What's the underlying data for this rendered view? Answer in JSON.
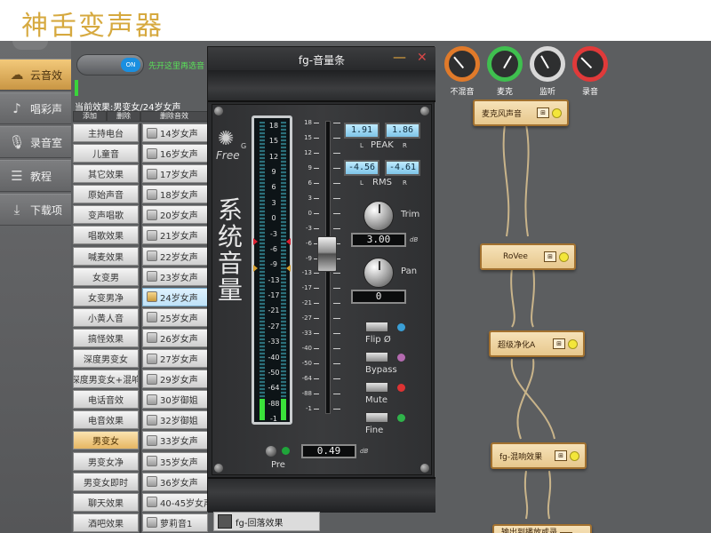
{
  "page_title": "神舌变声器",
  "nav": {
    "items": [
      {
        "label": "云音效",
        "icon": "cloud-icon"
      },
      {
        "label": "唱彩声",
        "icon": "microphone-hand-icon"
      },
      {
        "label": "录音室",
        "icon": "microphone-icon"
      },
      {
        "label": "教程",
        "icon": "tutorial-icon"
      },
      {
        "label": "下载项",
        "icon": "download-icon"
      }
    ]
  },
  "toggle": {
    "state": "ON",
    "hint": "先开这里再选音"
  },
  "effects": {
    "current_label": "当前效果:男变女/24岁女声",
    "headers": [
      "添加",
      "删除",
      "删除音效"
    ],
    "left_items": [
      "主持电台",
      "儿童音",
      "其它效果",
      "原始声音",
      "变声唱歌",
      "唱歌效果",
      "喊麦效果",
      "女变男",
      "女变男净",
      "小黄人音",
      "搞怪效果",
      "深度男变女",
      "深度男变女+混响",
      "电话音效",
      "电音效果",
      "男变女",
      "男变女净",
      "男变女即时",
      "聊天效果",
      "酒吧效果"
    ],
    "left_active": 15,
    "right_items": [
      "14岁女声",
      "16岁女声",
      "17岁女声",
      "18岁女声",
      "20岁女声",
      "21岁女声",
      "22岁女声",
      "23岁女声",
      "24岁女声",
      "25岁女声",
      "26岁女声",
      "27岁女声",
      "29岁女声",
      "30岁御姐",
      "32岁御姐",
      "33岁女声",
      "35岁女声",
      "36岁女声",
      "40-45岁女声",
      "萝莉音1"
    ],
    "right_selected": 8
  },
  "volume_window": {
    "title": "fg-音量条",
    "minimize": "—",
    "close": "✕",
    "logo_text": "Free",
    "logo_sup": "G",
    "big_label": [
      "系",
      "统",
      "音",
      "量"
    ],
    "meter_scale": [
      "18",
      "15",
      "12",
      "9",
      "6",
      "3",
      "0",
      "-3",
      "-6",
      "-9",
      "-13",
      "-17",
      "-21",
      "-27",
      "-33",
      "-40",
      "-50",
      "-64",
      "-88",
      "-1"
    ],
    "meter_levels": {
      "left": 0.07,
      "right": 0.07
    },
    "fader_scale": [
      "18",
      "15",
      "12",
      "9",
      "6",
      "3",
      "0",
      "-3",
      "-6",
      "-9",
      "-13",
      "-17",
      "-21",
      "-27",
      "-33",
      "-40",
      "-50",
      "-64",
      "-88",
      "-1"
    ],
    "peak": {
      "left": "1.91",
      "right": "1.86",
      "caption": "PEAK",
      "l": "L",
      "r": "R"
    },
    "rms": {
      "left": "-4.56",
      "right": "-4.61",
      "caption": "RMS",
      "l": "L",
      "r": "R"
    },
    "trim": {
      "label": "Trim",
      "value": "3.00",
      "unit": "dB"
    },
    "pan": {
      "label": "Pan",
      "value": "0"
    },
    "switches": [
      {
        "label": "Flip Ø",
        "led": "#3a9fd6"
      },
      {
        "label": "Bypass",
        "led": "#b46ab0"
      },
      {
        "label": "Mute",
        "led": "#d33"
      },
      {
        "label": "Fine",
        "led": "#2fb34a"
      }
    ],
    "pre_label": "Pre",
    "bottom_value": "0.49",
    "bottom_unit": "dB"
  },
  "bottom_tab": {
    "label": "fg-回落效果"
  },
  "toolbar": [
    {
      "label": "不混音",
      "color": "#e07a2a"
    },
    {
      "label": "麦克",
      "color": "#3fbf4f"
    },
    {
      "label": "监听",
      "color": "#d8d8d8"
    },
    {
      "label": "录音",
      "color": "#e03a3a"
    }
  ],
  "flow": {
    "nodes": [
      "麦克风声音",
      "RoVee",
      "超级净化A",
      "fg-混响效果",
      "输出到播放或录音"
    ]
  }
}
